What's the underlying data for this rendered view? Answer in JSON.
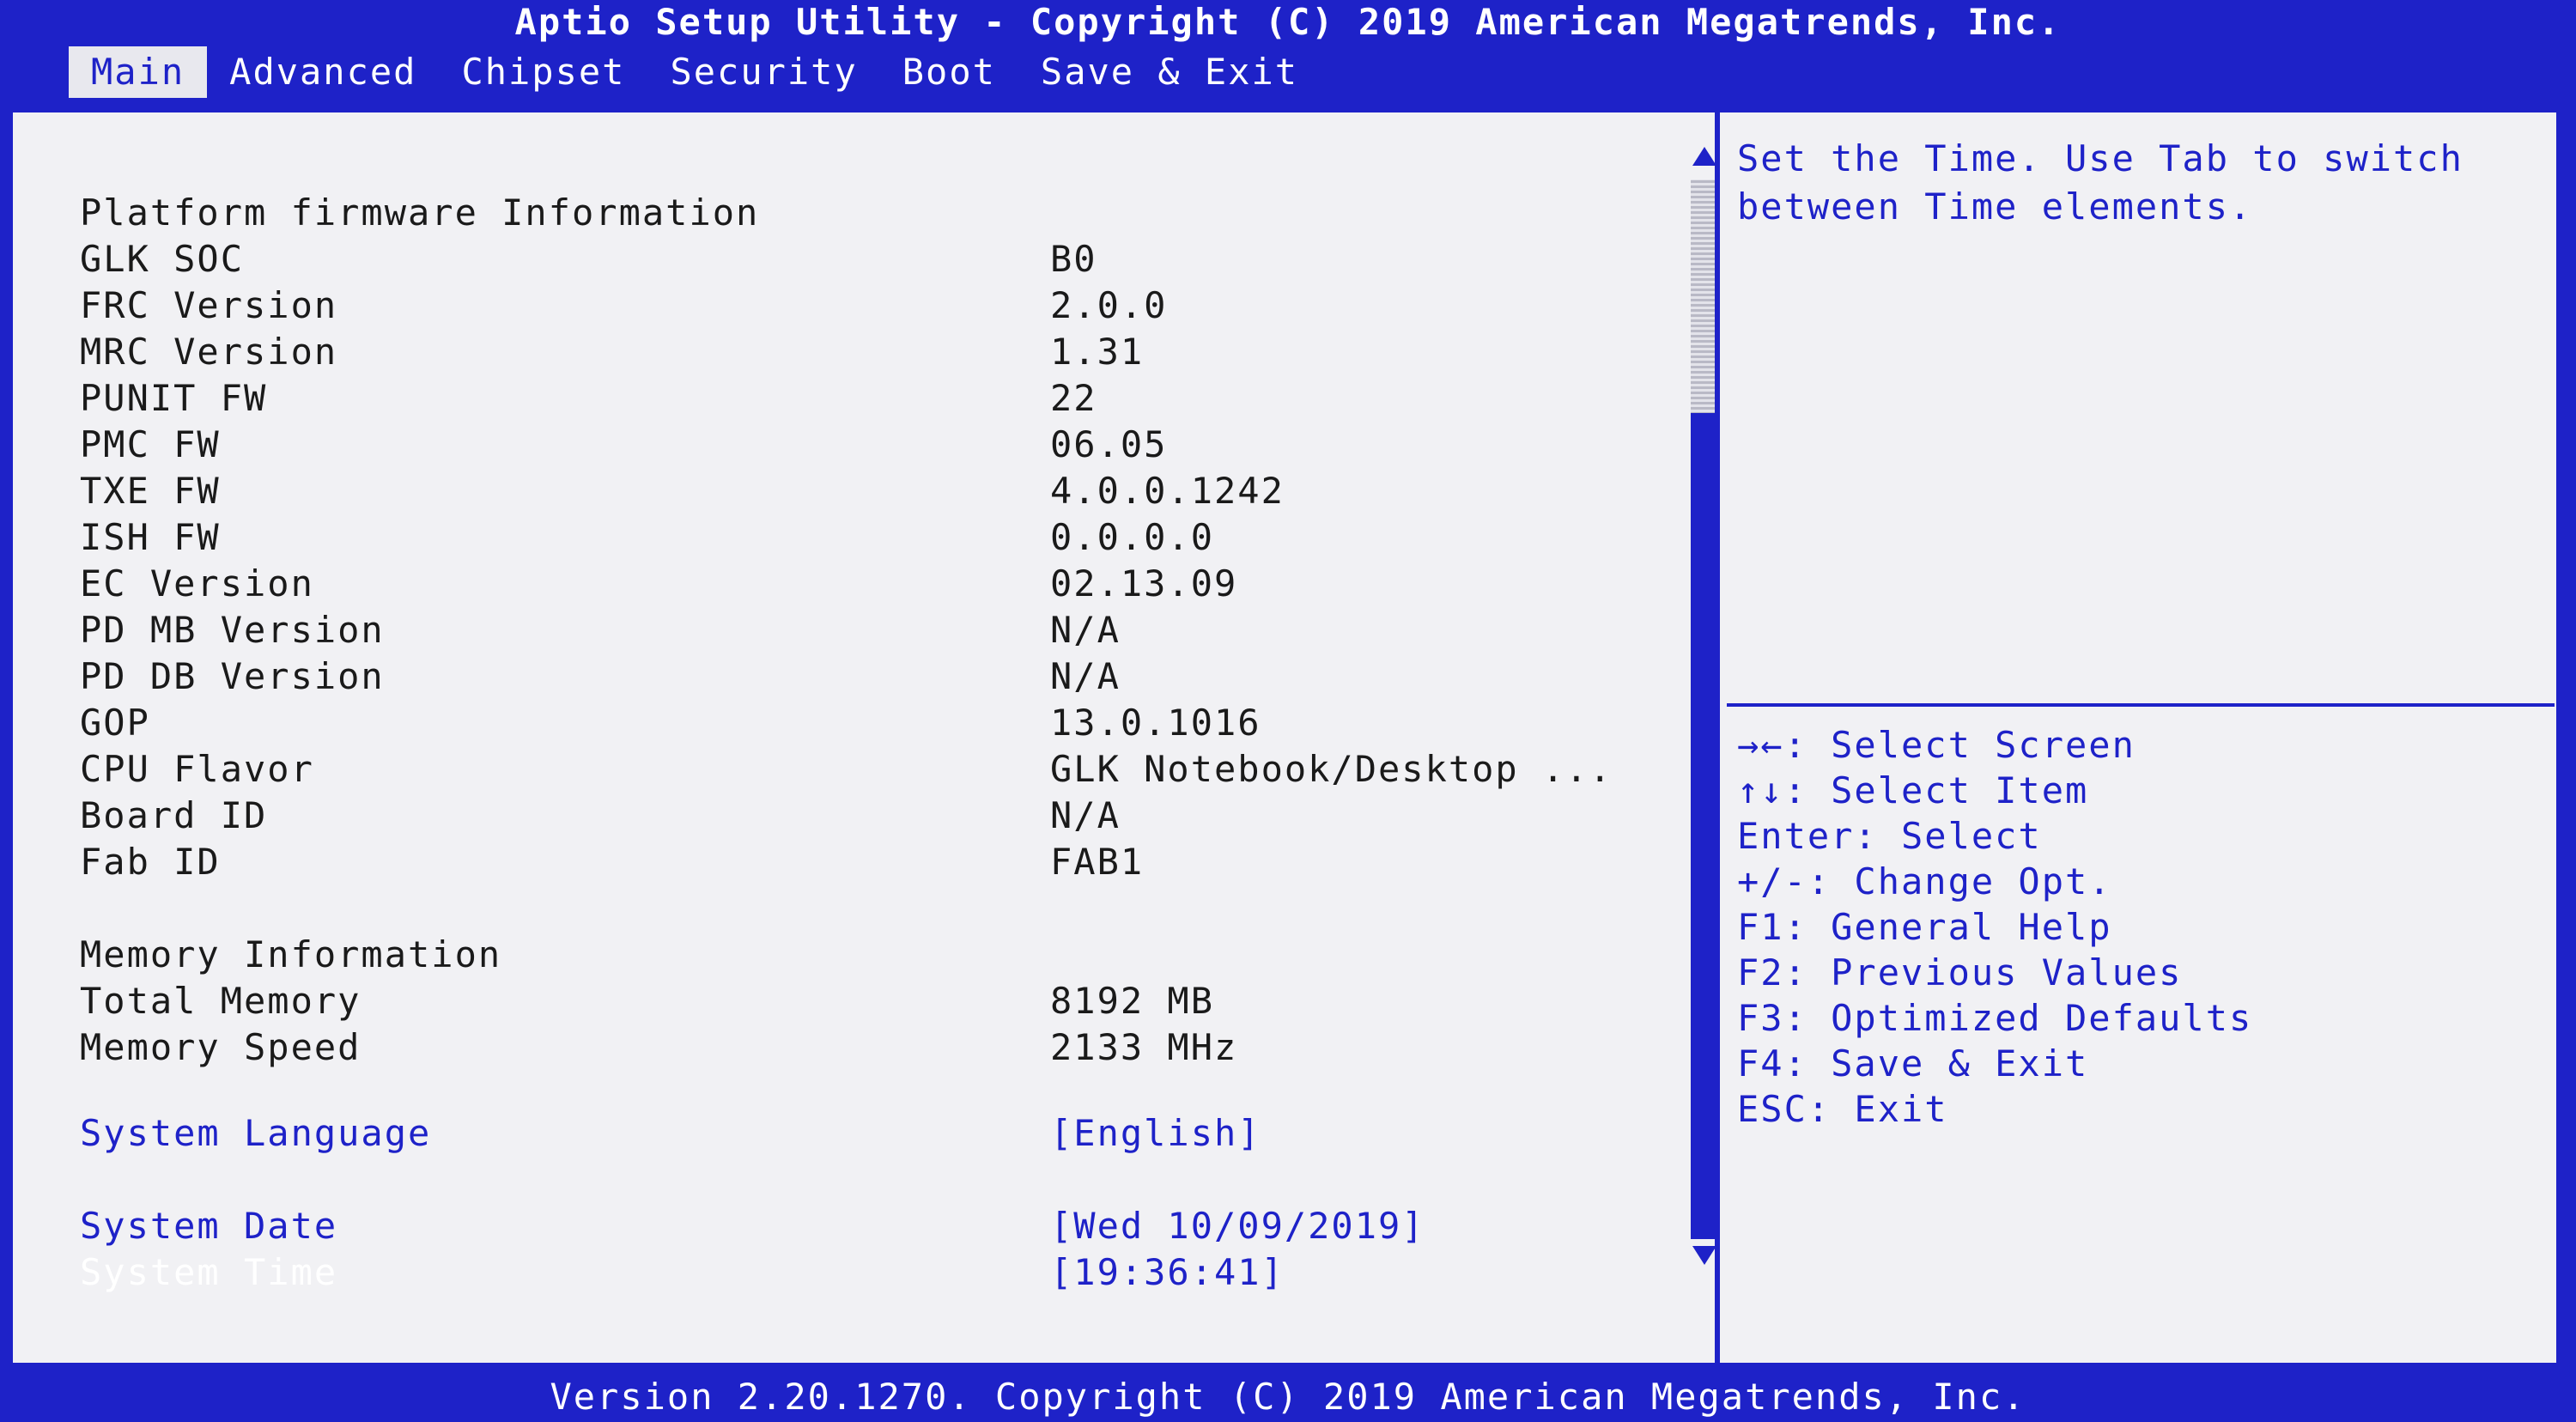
{
  "window": {
    "title": "Aptio Setup Utility - Copyright (C) 2019 American Megatrends, Inc."
  },
  "tabs": [
    {
      "label": "Main",
      "active": true
    },
    {
      "label": "Advanced"
    },
    {
      "label": "Chipset"
    },
    {
      "label": "Security"
    },
    {
      "label": "Boot"
    },
    {
      "label": "Save & Exit"
    }
  ],
  "main": {
    "platform_section": "Platform firmware Information",
    "platform_rows": [
      {
        "label": "GLK SOC",
        "value": "B0"
      },
      {
        "label": "FRC Version",
        "value": "2.0.0"
      },
      {
        "label": "MRC Version",
        "value": "1.31"
      },
      {
        "label": "PUNIT FW",
        "value": "22"
      },
      {
        "label": "PMC FW",
        "value": "06.05"
      },
      {
        "label": "TXE FW",
        "value": "4.0.0.1242"
      },
      {
        "label": "ISH FW",
        "value": "0.0.0.0"
      },
      {
        "label": "EC Version",
        "value": "02.13.09"
      },
      {
        "label": "PD MB Version",
        "value": "N/A"
      },
      {
        "label": "PD DB Version",
        "value": "N/A"
      },
      {
        "label": "GOP",
        "value": "13.0.1016"
      },
      {
        "label": "CPU Flavor",
        "value": "GLK Notebook/Desktop ..."
      },
      {
        "label": "Board ID",
        "value": "N/A"
      },
      {
        "label": "Fab ID",
        "value": "FAB1"
      }
    ],
    "memory_section": "Memory Information",
    "memory_rows": [
      {
        "label": "Total Memory",
        "value": "8192 MB"
      },
      {
        "label": "Memory Speed",
        "value": "2133 MHz"
      }
    ],
    "settings": {
      "language": {
        "label": "System Language",
        "value": "[English]"
      },
      "date": {
        "label": "System Date",
        "value": "[Wed 10/09/2019]"
      },
      "time": {
        "label": "System Time",
        "value": "[19:36:41]"
      }
    }
  },
  "help": {
    "text": "Set the Time. Use Tab to switch between Time elements."
  },
  "keys": [
    "→←: Select Screen",
    "↑↓: Select Item",
    "Enter: Select",
    "+/-: Change Opt.",
    "F1: General Help",
    "F2: Previous Values",
    "F3: Optimized Defaults",
    "F4: Save & Exit",
    "ESC: Exit"
  ],
  "footer": {
    "text": "Version 2.20.1270. Copyright (C) 2019 American Megatrends, Inc."
  },
  "colors": {
    "bios_blue": "#1e22c8",
    "panel_bg": "#f1f1f4",
    "text_dark": "#1a1a1a",
    "selected_text": "#ffffff"
  }
}
